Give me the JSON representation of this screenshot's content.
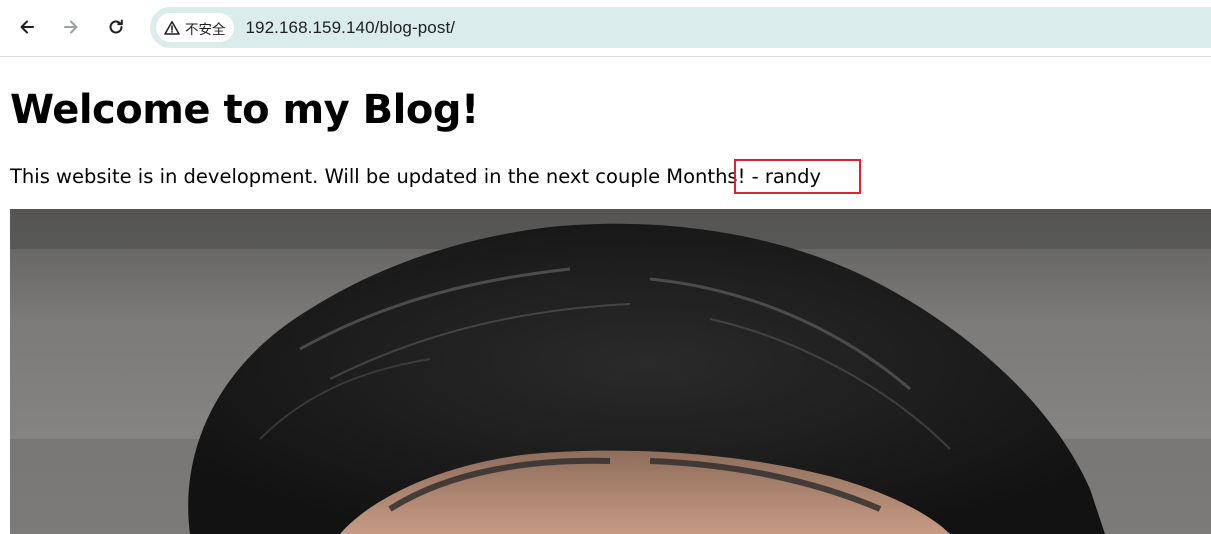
{
  "browser": {
    "security_label": "不安全",
    "url": "192.168.159.140/blog-post/",
    "icons": {
      "back": "arrow-left-icon",
      "forward": "arrow-right-icon",
      "reload": "reload-icon",
      "security": "warning-triangle-icon"
    }
  },
  "page": {
    "title": "Welcome to my Blog!",
    "dev_text": "This website is in development. Will be updated in the next couple Months! - randy",
    "highlight_color": "#d9252f"
  },
  "photo": {
    "subject": "portrait-photo"
  }
}
